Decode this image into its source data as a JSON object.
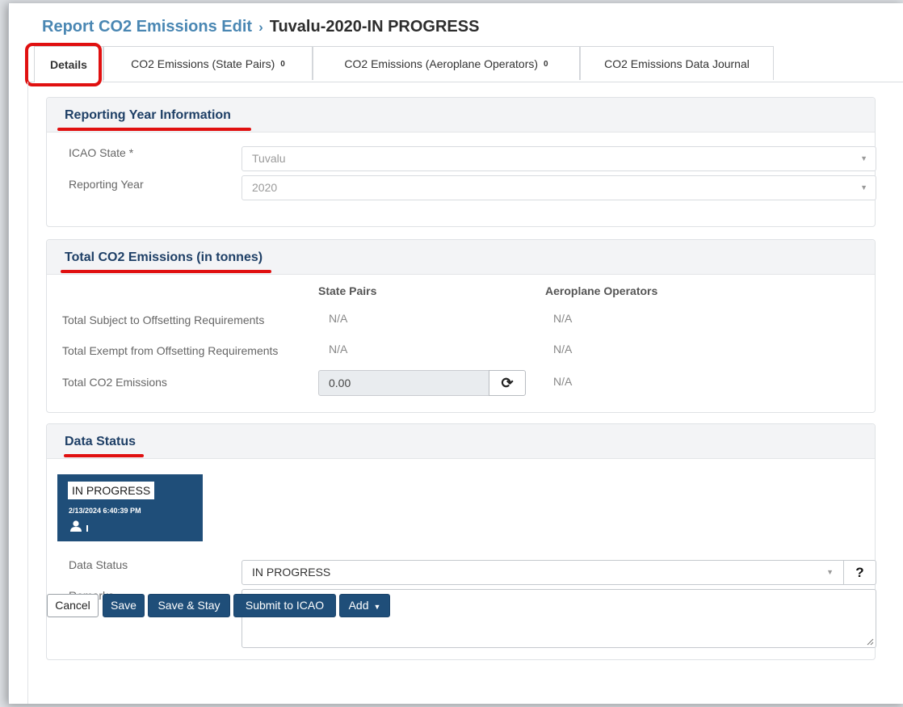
{
  "breadcrumb": {
    "parent": "Report CO2 Emissions Edit",
    "separator": "›",
    "current": "Tuvalu-2020-IN PROGRESS"
  },
  "tabs": [
    {
      "label": "Details",
      "count": ""
    },
    {
      "label": "CO2 Emissions (State Pairs)",
      "count": "0"
    },
    {
      "label": "CO2 Emissions (Aeroplane Operators)",
      "count": "0"
    },
    {
      "label": "CO2 Emissions Data Journal",
      "count": ""
    }
  ],
  "reporting_year": {
    "title": "Reporting Year Information",
    "state_label": "ICAO State *",
    "state_value": "Tuvalu",
    "year_label": "Reporting Year",
    "year_value": "2020"
  },
  "totals": {
    "title": "Total CO2 Emissions (in tonnes)",
    "col_state_pairs": "State Pairs",
    "col_operators": "Aeroplane Operators",
    "rows": [
      {
        "label": "Total Subject to Offsetting Requirements",
        "state_pairs": "N/A",
        "operators": "N/A"
      },
      {
        "label": "Total Exempt from Offsetting Requirements",
        "state_pairs": "N/A",
        "operators": "N/A"
      },
      {
        "label": "Total CO2 Emissions",
        "state_pairs": "0.00",
        "operators": "N/A"
      }
    ]
  },
  "data_status": {
    "title": "Data Status",
    "card_status": "IN PROGRESS",
    "card_timestamp": "2/13/2024 6:40:39 PM",
    "status_label": "Data Status",
    "status_value": "IN PROGRESS",
    "help_label": "?",
    "remarks_label": "Remarks",
    "remarks_value": ""
  },
  "actions": {
    "cancel": "Cancel",
    "save": "Save",
    "save_stay": "Save & Stay",
    "submit": "Submit to ICAO",
    "add": "Add"
  },
  "colors": {
    "primary": "#1f4e79",
    "link": "#4a87b3",
    "highlight": "#e01010"
  },
  "icons": [
    "chevron-right-icon",
    "chevron-down-icon",
    "refresh-icon",
    "user-icon",
    "help-icon",
    "resize-grip-icon",
    "caret-down-icon"
  ]
}
